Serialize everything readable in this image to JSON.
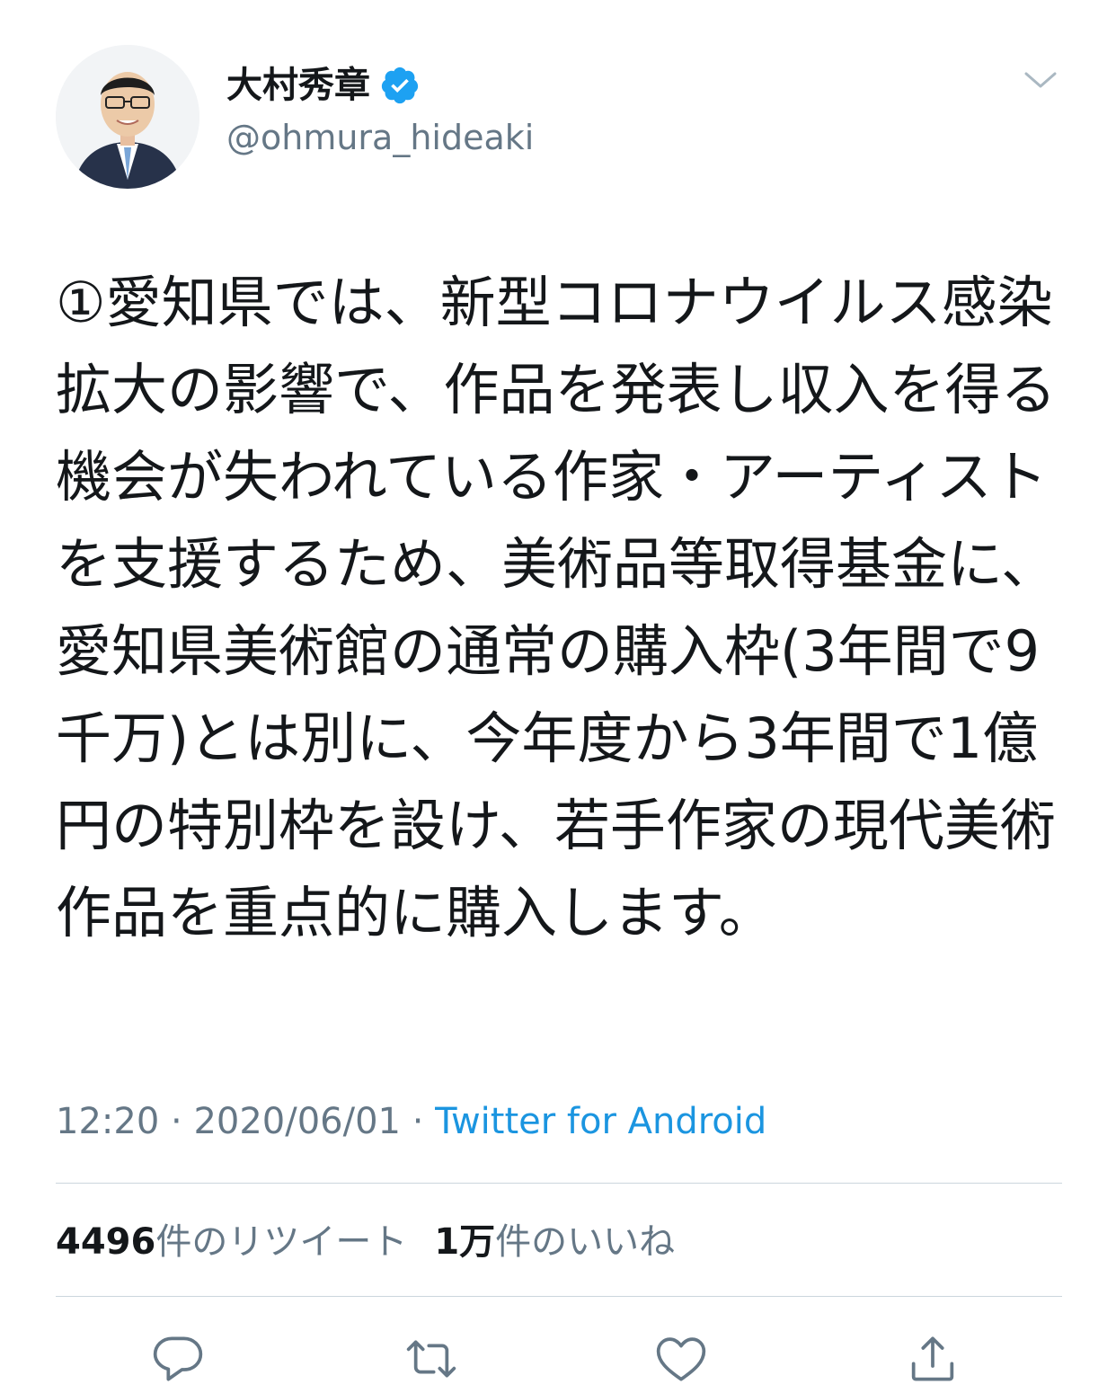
{
  "tweet": {
    "display_name": "大村秀章",
    "handle": "@ohmura_hideaki",
    "text": "①愛知県では、新型コロナウイルス感染拡大の影響で、作品を発表し収入を得る機会が失われている作家・アーティストを支援するため、美術品等取得基金に、愛知県美術館の通常の購入枠(3年間で9千万)とは別に、今年度から3年間で1億円の特別枠を設け、若手作家の現代美術作品を重点的に購入します。",
    "time": "12:20",
    "separator": "·",
    "date": "2020/06/01",
    "source": "Twitter for Android"
  },
  "stats": {
    "retweet_count": "4496",
    "retweet_label": "件のリツイート",
    "like_count": "1万",
    "like_label": "件のいいね"
  },
  "icons": {
    "verified": "verified-badge-icon",
    "menu": "chevron-down-icon",
    "reply": "reply-icon",
    "retweet": "retweet-icon",
    "like": "heart-icon",
    "share": "share-icon"
  },
  "colors": {
    "verified_blue": "#1da1f2",
    "link_blue": "#1b95e0",
    "secondary_text": "#657786",
    "icon_gray": "#657786",
    "divider": "#ccd6dd"
  }
}
